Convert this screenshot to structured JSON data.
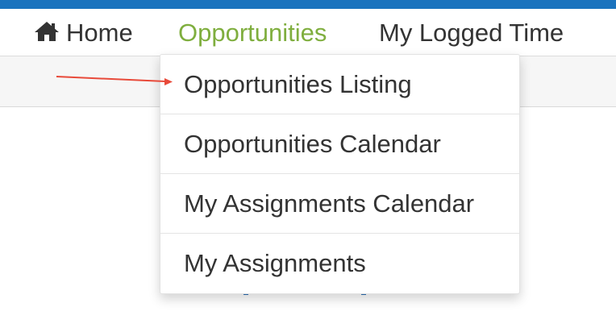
{
  "nav": {
    "items": [
      {
        "label": "Home",
        "icon": "home-icon"
      },
      {
        "label": "Opportunities",
        "active": true
      },
      {
        "label": "My Logged Time"
      }
    ]
  },
  "dropdown": {
    "items": [
      {
        "label": "Opportunities Listing"
      },
      {
        "label": "Opportunities Calendar"
      },
      {
        "label": "My Assignments Calendar"
      },
      {
        "label": "My Assignments"
      }
    ]
  },
  "colors": {
    "top_strip": "#1a73be",
    "active_nav": "#7fae3e",
    "arrow": "#e84a3a",
    "text": "#333333"
  }
}
